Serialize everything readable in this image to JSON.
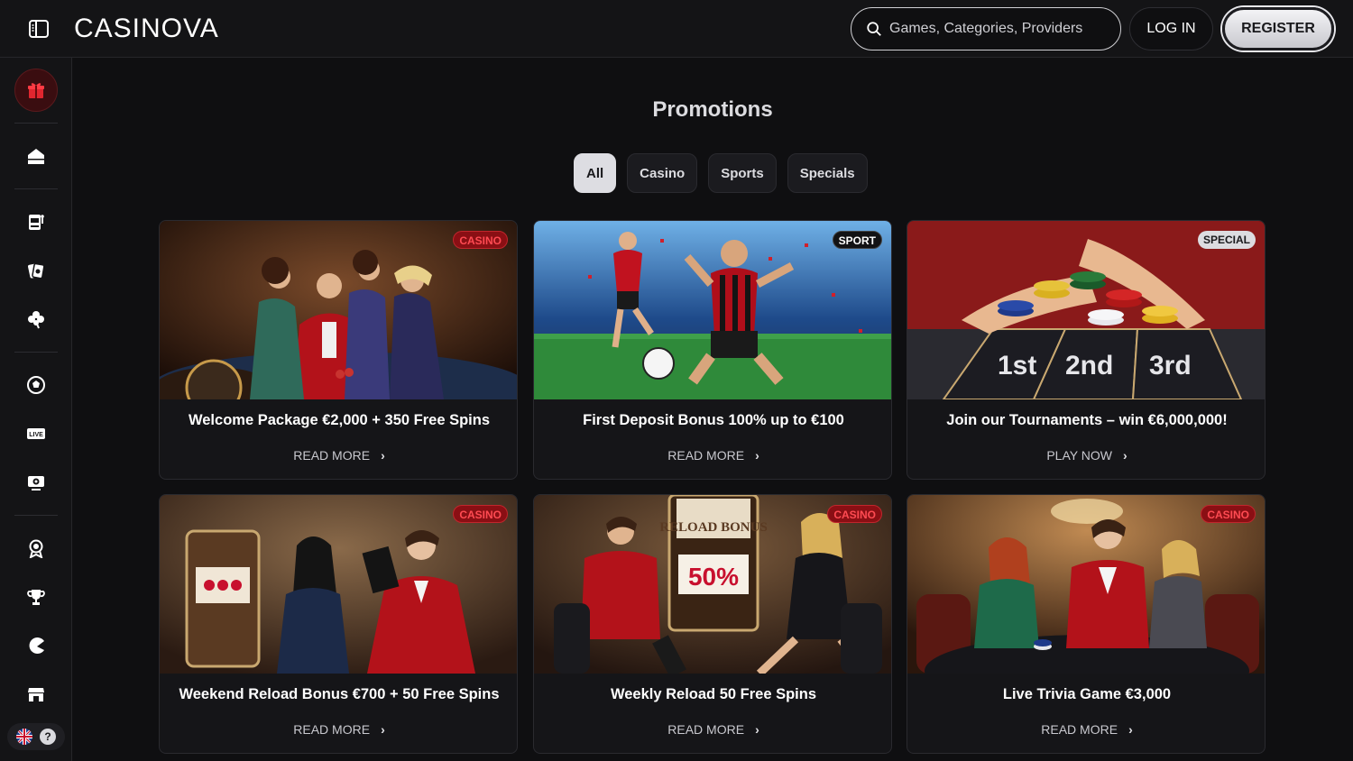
{
  "brand": {
    "name": "CASINOVA"
  },
  "search": {
    "placeholder": "Games, Categories, Providers"
  },
  "header": {
    "login_label": "LOG IN",
    "register_label": "REGISTER"
  },
  "sidebar": {
    "items": [
      {
        "icon": "home-icon"
      },
      {
        "icon": "slot-machine-icon"
      },
      {
        "icon": "poker-chip-icon"
      },
      {
        "icon": "clover-icon"
      },
      {
        "icon": "soccer-ball-icon"
      },
      {
        "icon": "live-icon",
        "label": "LIVE"
      },
      {
        "icon": "virtual-sports-icon"
      },
      {
        "icon": "badge-icon"
      },
      {
        "icon": "trophy-icon"
      },
      {
        "icon": "pacman-icon"
      },
      {
        "icon": "shop-icon"
      }
    ]
  },
  "page": {
    "title": "Promotions"
  },
  "filters": [
    "All",
    "Casino",
    "Sports",
    "Specials"
  ],
  "filters_active": "All",
  "promos": [
    {
      "badge": "CASINO",
      "title": "Welcome Package €2,000 + 350 Free Spins",
      "cta": "READ MORE"
    },
    {
      "badge": "SPORT",
      "title": "First Deposit Bonus 100% up to €100",
      "cta": "READ MORE"
    },
    {
      "badge": "SPECIAL",
      "title": "Join our Tournaments – win €6,000,000!",
      "cta": "PLAY NOW"
    },
    {
      "badge": "CASINO",
      "title": "Weekend Reload Bonus €700 + 50 Free Spins",
      "cta": "READ MORE"
    },
    {
      "badge": "CASINO",
      "title": "Weekly Reload 50 Free Spins",
      "cta": "READ MORE"
    },
    {
      "badge": "CASINO",
      "title": "Live Trivia Game €3,000",
      "cta": "READ MORE"
    }
  ],
  "promo_art": {
    "reload_sign": "RELOAD BONUS",
    "reload_percent": "50%",
    "podium": [
      "1st",
      "2nd",
      "3rd"
    ]
  },
  "colors": {
    "accent_red": "#c0262c",
    "background": "#0f0f11",
    "card": "#151518"
  }
}
